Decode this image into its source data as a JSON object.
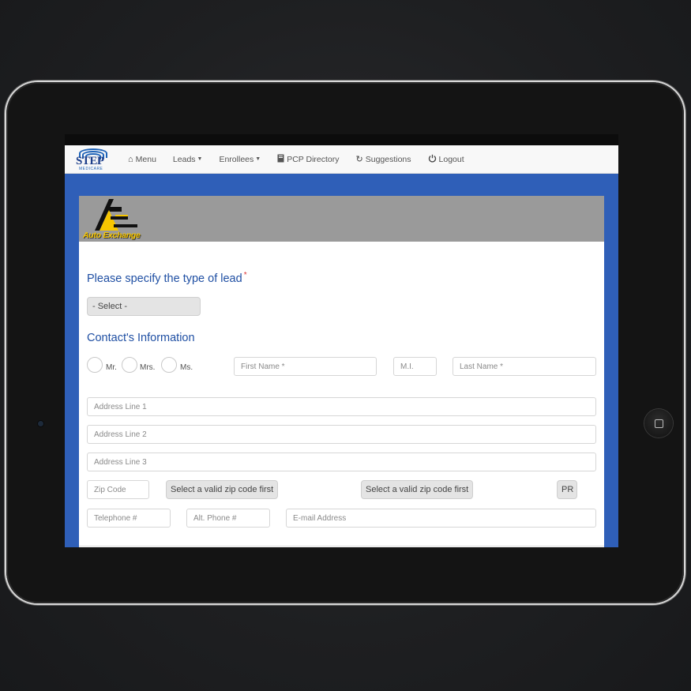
{
  "nav": {
    "logo_text": "STEP",
    "logo_sub": "MEDICARE",
    "items": [
      {
        "label": "Menu",
        "icon": "home-icon"
      },
      {
        "label": "Leads",
        "icon": "caret-down-icon"
      },
      {
        "label": "Enrollees",
        "icon": "caret-down-icon"
      },
      {
        "label": "PCP Directory",
        "icon": "book-icon"
      },
      {
        "label": "Suggestions",
        "icon": "refresh-icon"
      },
      {
        "label": "Logout",
        "icon": "power-icon"
      }
    ]
  },
  "brand": {
    "name": "Auto Exchange",
    "accent": "#f7c600"
  },
  "lead": {
    "heading": "Please specify the type of lead",
    "required_mark": "*",
    "select_value": "- Select -"
  },
  "contact": {
    "heading": "Contact's Information",
    "titles": [
      "Mr.",
      "Mrs.",
      "Ms."
    ],
    "first_name_placeholder": "First Name *",
    "mi_placeholder": "M.I.",
    "last_name_placeholder": "Last Name *",
    "address1_placeholder": "Address Line 1",
    "address2_placeholder": "Address Line 2",
    "address3_placeholder": "Address Line 3",
    "zip_placeholder": "Zip Code",
    "city_select": "Select a valid zip code first",
    "state_select": "Select a valid zip code first",
    "country_code": "PR",
    "phone_placeholder": "Telephone #",
    "alt_phone_placeholder": "Alt. Phone #",
    "email_placeholder": "E-mail Address"
  },
  "colors": {
    "heading_blue": "#1f4fa3",
    "background_blue": "#2f5fb8",
    "header_grey": "#9a9a9a"
  }
}
